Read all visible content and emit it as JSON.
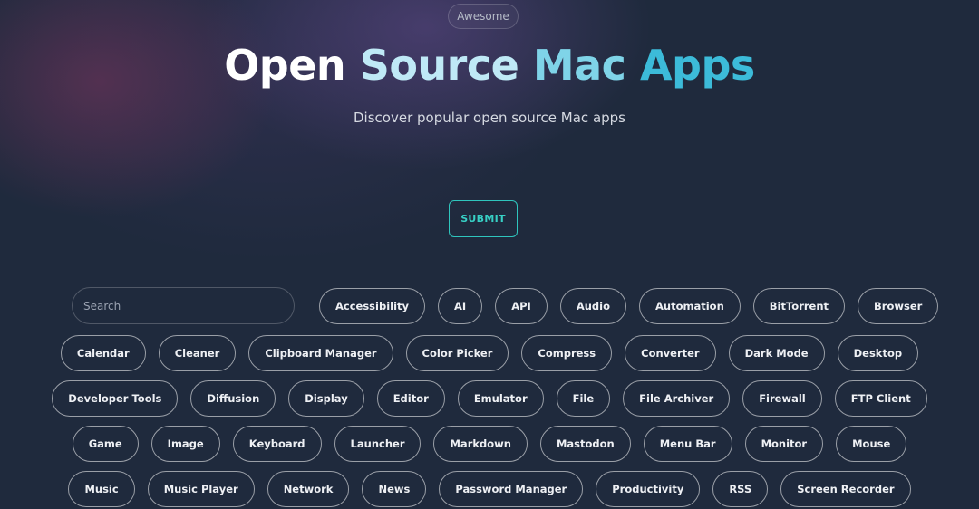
{
  "header": {
    "badge": "Awesome",
    "title_words": [
      "Open",
      "Source",
      "Mac",
      "Apps"
    ],
    "subtitle": "Discover popular open source Mac apps",
    "submit_label": "SUBMIT"
  },
  "search": {
    "placeholder": "Search",
    "value": ""
  },
  "colors": {
    "background": "#1f2a3d",
    "accent": "#37d0c5",
    "title_gradient": [
      "#ffffff",
      "#bfe9f6",
      "#7fd4e8",
      "#3cbbd9"
    ]
  },
  "tag_rows": [
    [
      "Accessibility",
      "AI",
      "API",
      "Audio",
      "Automation",
      "BitTorrent",
      "Browser"
    ],
    [
      "Calendar",
      "Cleaner",
      "Clipboard Manager",
      "Color Picker",
      "Compress",
      "Converter",
      "Dark Mode",
      "Desktop"
    ],
    [
      "Developer Tools",
      "Diffusion",
      "Display",
      "Editor",
      "Emulator",
      "File",
      "File Archiver",
      "Firewall",
      "FTP Client"
    ],
    [
      "Game",
      "Image",
      "Keyboard",
      "Launcher",
      "Markdown",
      "Mastodon",
      "Menu Bar",
      "Monitor",
      "Mouse"
    ],
    [
      "Music",
      "Music Player",
      "Network",
      "News",
      "Password Manager",
      "Productivity",
      "RSS",
      "Screen Recorder"
    ]
  ]
}
